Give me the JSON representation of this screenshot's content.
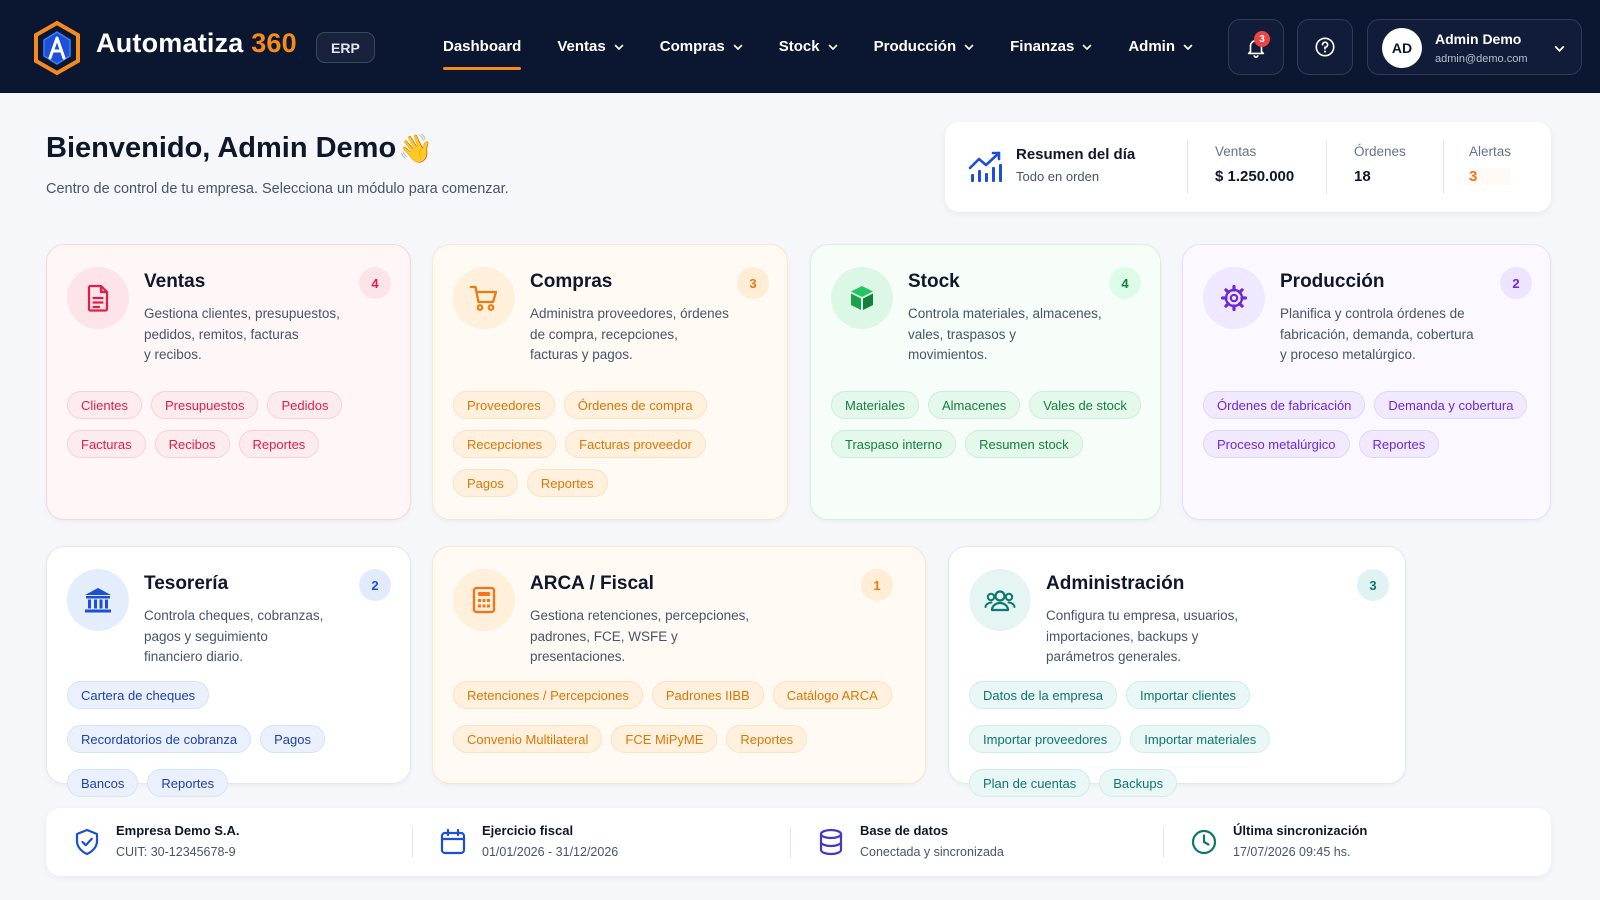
{
  "app": {
    "brand_name": "Automatiza",
    "brand_number": "360",
    "badge": "ERP",
    "brand_accent": "#f58a1f"
  },
  "nav": {
    "items": [
      {
        "label": "Dashboard"
      },
      {
        "label": "Ventas"
      },
      {
        "label": "Compras"
      },
      {
        "label": "Stock"
      },
      {
        "label": "Producción"
      },
      {
        "label": "Finanzas"
      },
      {
        "label": "Admin"
      }
    ],
    "active": "Dashboard"
  },
  "topbar": {
    "notifications_count": "3",
    "help_icon": "help-circle-icon",
    "notifications_icon": "bell-icon"
  },
  "user": {
    "initials": "AD",
    "name": "Admin Demo",
    "email": "admin@demo.com"
  },
  "greeting": {
    "title": "Bienvenido, Admin Demo",
    "emoji": "👋",
    "subtitle": "Centro de control de tu empresa. Selecciona un módulo para comenzar."
  },
  "summary": {
    "title": "Resumen del día",
    "subtitle": "Todo en orden",
    "ventas_label": "Ventas",
    "ventas_value": "$ 1.250.000",
    "ordenes_label": "Órdenes",
    "ordenes_value": "18",
    "alertas_label": "Alertas",
    "alertas_value": "3"
  },
  "modules": [
    {
      "title": "Ventas",
      "count": "4",
      "icon": "document-icon",
      "desc": [
        "Gestiona clientes, presupuestos,",
        "pedidos, remitos, facturas",
        "y recibos."
      ],
      "chips": [
        "Clientes",
        "Presupuestos",
        "Pedidos",
        "Facturas",
        "Recibos",
        "Reportes"
      ]
    },
    {
      "title": "Compras",
      "count": "3",
      "icon": "cart-icon",
      "desc": [
        "Administra proveedores, órdenes",
        "de compra, recepciones,",
        "facturas y pagos."
      ],
      "chips": [
        "Proveedores",
        "Órdenes de compra",
        "Recepciones",
        "Facturas proveedor",
        "Pagos",
        "Reportes"
      ]
    },
    {
      "title": "Stock",
      "count": "4",
      "icon": "box-icon",
      "desc": [
        "Controla materiales, almacenes,",
        "vales, traspasos y",
        "movimientos."
      ],
      "chips": [
        "Materiales",
        "Almacenes",
        "Vales de stock",
        "Traspaso interno",
        "Resumen stock"
      ]
    },
    {
      "title": "Producción",
      "count": "2",
      "icon": "gear-icon",
      "desc": [
        "Planifica y controla órdenes de",
        "fabricación, demanda, cobertura",
        "y proceso metalúrgico."
      ],
      "chips": [
        "Órdenes de fabricación",
        "Demanda y cobertura",
        "Proceso metalúrgico",
        "Reportes"
      ]
    },
    {
      "title": "Tesorería",
      "count": "2",
      "icon": "bank-icon",
      "desc": [
        "Controla cheques, cobranzas,",
        "pagos y seguimiento",
        "financiero diario."
      ],
      "chips": [
        "Cartera de cheques",
        "Recordatorios de cobranza",
        "Pagos",
        "Bancos",
        "Reportes"
      ]
    },
    {
      "title": "ARCA / Fiscal",
      "count": "1",
      "icon": "calculator-icon",
      "desc": [
        "Gestiona retenciones, percepciones,",
        "padrones, FCE, WSFE y",
        "presentaciones."
      ],
      "chips": [
        "Retenciones / Percepciones",
        "Padrones IIBB",
        "Catálogo ARCA",
        "Convenio Multilateral",
        "FCE MiPyME",
        "Reportes"
      ]
    },
    {
      "title": "Administración",
      "count": "3",
      "icon": "users-icon",
      "desc": [
        "Configura tu empresa, usuarios,",
        "importaciones, backups y",
        "parámetros generales."
      ],
      "chips": [
        "Datos de la empresa",
        "Importar clientes",
        "Importar proveedores",
        "Importar materiales",
        "Plan de cuentas",
        "Backups"
      ]
    }
  ],
  "footer": [
    {
      "title": "Empresa Demo S.A.",
      "sub": "CUIT: 30-12345678-9",
      "icon": "shield-check-icon"
    },
    {
      "title": "Ejercicio fiscal",
      "sub": "01/01/2026 - 31/12/2026",
      "icon": "calendar-icon"
    },
    {
      "title": "Base de datos",
      "sub": "Conectada y sincronizada",
      "icon": "database-icon"
    },
    {
      "title": "Última sincronización",
      "sub": "17/07/2026 09:45 hs.",
      "icon": "clock-icon"
    }
  ],
  "colors": {
    "topbar": "#0b1630",
    "ventas": "#e11d48",
    "compras": "#ea7a12",
    "stock": "#16a34a",
    "produccion": "#6d28d9",
    "tesoreria": "#1d4ed8",
    "fiscal": "#f97316",
    "administracion": "#0f766e"
  }
}
